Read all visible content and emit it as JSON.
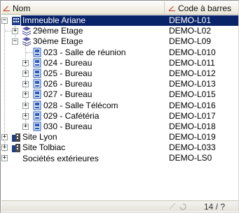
{
  "columns": {
    "name": "Nom",
    "code": "Code à barres"
  },
  "rows": [
    {
      "name": "Immeuble Ariane",
      "code": "DEMO-L01",
      "selected": true
    },
    {
      "name": "29ème Etage",
      "code": "DEMO-L02"
    },
    {
      "name": "30ème Etage",
      "code": "DEMO-L09"
    },
    {
      "name": "023 - Salle de réunion",
      "code": "DEMO-L010"
    },
    {
      "name": "024 - Bureau",
      "code": "DEMO-L011"
    },
    {
      "name": "025 - Bureau",
      "code": "DEMO-L012"
    },
    {
      "name": "026 - Bureau",
      "code": "DEMO-L013"
    },
    {
      "name": "027 - Bureau",
      "code": "DEMO-L015"
    },
    {
      "name": "028 - Salle Télécom",
      "code": "DEMO-L016"
    },
    {
      "name": "029 - Cafétéria",
      "code": "DEMO-L017"
    },
    {
      "name": "030 - Bureau",
      "code": "DEMO-L018"
    },
    {
      "name": "Site Lyon",
      "code": "DEMO-L019"
    },
    {
      "name": "Site Tolbiac",
      "code": "DEMO-L033"
    },
    {
      "name": "Sociétés extérieures",
      "code": "DEMO-LS0"
    }
  ],
  "status": {
    "pager": "14 / ?"
  },
  "colors": {
    "selection": "#0a246a",
    "building_icon": "#1f3f86",
    "room_icon": "#2c5bb8"
  }
}
